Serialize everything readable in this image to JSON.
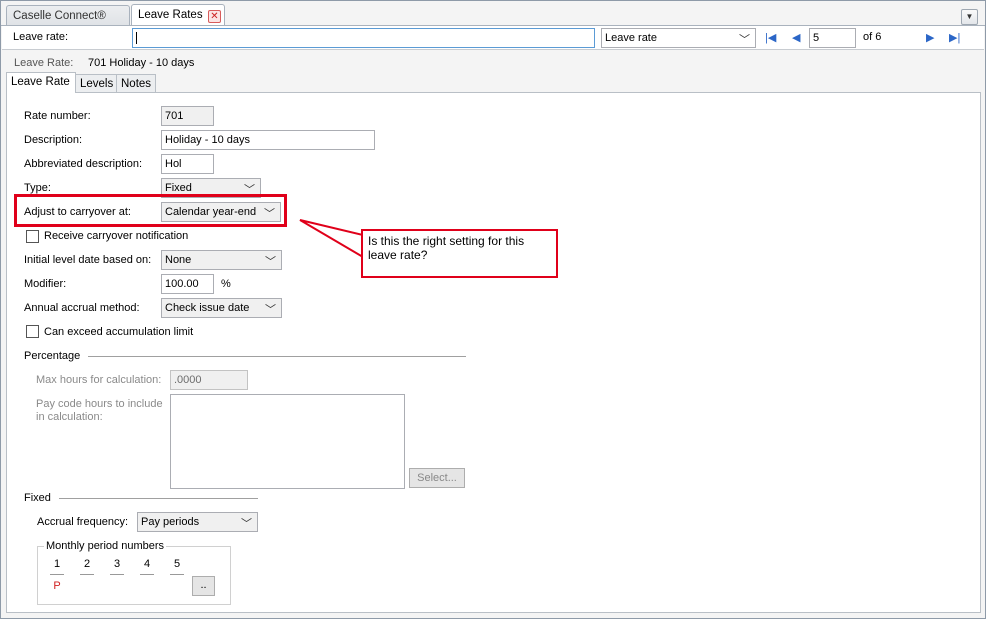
{
  "doc_tabs": {
    "inactive_label": "Caselle Connect®",
    "active_label": "Leave Rates"
  },
  "lookup": {
    "label": "Leave rate:",
    "value": "",
    "field_select": "Leave rate",
    "record_number": "5",
    "record_total": "of 6"
  },
  "caption": {
    "label": "Leave Rate:",
    "value": "701  Holiday - 10 days"
  },
  "tabs": [
    "Leave Rate",
    "Levels",
    "Notes"
  ],
  "form": {
    "rate_number_label": "Rate number:",
    "rate_number": "701",
    "description_label": "Description:",
    "description": "Holiday - 10 days",
    "abbrev_label": "Abbreviated description:",
    "abbrev": "Hol",
    "type_label": "Type:",
    "type": "Fixed",
    "carryover_label": "Adjust to carryover at:",
    "carryover": "Calendar year-end",
    "receive_notification_label": "Receive carryover notification",
    "initial_level_label": "Initial level date based on:",
    "initial_level": "None",
    "modifier_label": "Modifier:",
    "modifier": "100.00",
    "modifier_unit": "%",
    "accrual_method_label": "Annual accrual method:",
    "accrual_method": "Check issue date",
    "exceed_limit_label": "Can exceed accumulation limit"
  },
  "percentage": {
    "section_label": "Percentage",
    "max_hours_label": "Max hours for calculation:",
    "max_hours": ".0000",
    "pay_code_label_1": "Pay code hours to include",
    "pay_code_label_2": "in calculation:",
    "select_button": "Select..."
  },
  "fixed": {
    "section_label": "Fixed",
    "frequency_label": "Accrual frequency:",
    "frequency": "Pay periods",
    "monthly_label": "Monthly period numbers",
    "periods": [
      "1",
      "2",
      "3",
      "4",
      "5"
    ],
    "period_1_flag": "P",
    "more_button": ".."
  },
  "callout": {
    "text": "Is this the right setting for this leave rate?"
  },
  "colors": {
    "annotation_red": "#e0001a",
    "nav_blue": "#2b66c7"
  }
}
